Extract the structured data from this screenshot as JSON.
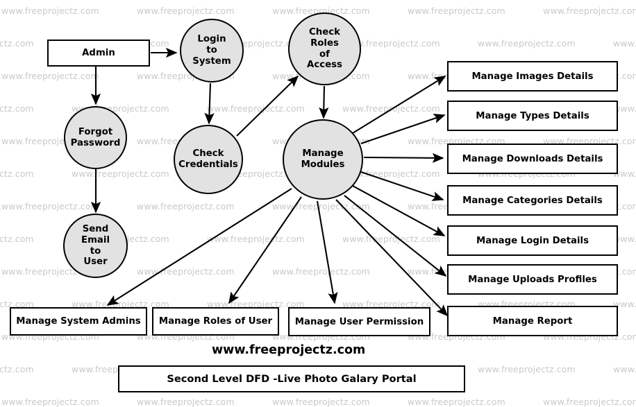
{
  "meta": {
    "kind": "data-flow-diagram",
    "level": "Second Level DFD",
    "brand_text": "www.freeprojectz.com",
    "title_caption": "Second Level DFD -Live Photo Galary Portal",
    "watermark_text": "www.freeprojectz.com",
    "colors": {
      "process_fill": "#e2e2e2",
      "stroke": "#000000",
      "entity_fill": "#ffffff",
      "watermark": "#c9c9c9",
      "background": "#ffffff"
    }
  },
  "nodes": {
    "external_entity": {
      "label": "Admin"
    },
    "processes": [
      {
        "id": "login",
        "label": "Login\nto\nSystem"
      },
      {
        "id": "forgot",
        "label": "Forgot\nPassword"
      },
      {
        "id": "credentials",
        "label": "Check\nCredentials"
      },
      {
        "id": "roles",
        "label": "Check\nRoles\nof\nAccess"
      },
      {
        "id": "sendmail",
        "label": "Send\nEmail\nto\nUser"
      },
      {
        "id": "modules",
        "label": "Manage\nModules"
      }
    ],
    "right_stores": [
      {
        "id": "images",
        "label": "Manage Images Details"
      },
      {
        "id": "types",
        "label": "Manage Types Details"
      },
      {
        "id": "downloads",
        "label": "Manage Downloads Details"
      },
      {
        "id": "categories",
        "label": "Manage Categories Details"
      },
      {
        "id": "login_details",
        "label": "Manage Login Details"
      },
      {
        "id": "uploads",
        "label": "Manage Uploads Profiles"
      },
      {
        "id": "report",
        "label": "Manage  Report"
      }
    ],
    "bottom_stores": [
      {
        "id": "sysadmins",
        "label": "Manage System Admins"
      },
      {
        "id": "roles_of_user",
        "label": "Manage Roles of User"
      },
      {
        "id": "user_permission",
        "label": "Manage User Permission"
      }
    ]
  },
  "flows": [
    {
      "from": "Admin",
      "to": "Login to System"
    },
    {
      "from": "Admin",
      "to": "Forgot Password"
    },
    {
      "from": "Login to System",
      "to": "Check Credentials"
    },
    {
      "from": "Check Credentials",
      "to": "Check Roles of Access"
    },
    {
      "from": "Check Roles of Access",
      "to": "Manage Modules"
    },
    {
      "from": "Forgot Password",
      "to": "Send Email to User"
    },
    {
      "from": "Manage Modules",
      "to": "Manage Images Details"
    },
    {
      "from": "Manage Modules",
      "to": "Manage Types Details"
    },
    {
      "from": "Manage Modules",
      "to": "Manage Downloads Details"
    },
    {
      "from": "Manage Modules",
      "to": "Manage Categories Details"
    },
    {
      "from": "Manage Modules",
      "to": "Manage Login Details"
    },
    {
      "from": "Manage Modules",
      "to": "Manage Uploads Profiles"
    },
    {
      "from": "Manage Modules",
      "to": "Manage  Report"
    },
    {
      "from": "Manage Modules",
      "to": "Manage System Admins"
    },
    {
      "from": "Manage Modules",
      "to": "Manage Roles of User"
    },
    {
      "from": "Manage Modules",
      "to": "Manage User Permission"
    }
  ]
}
